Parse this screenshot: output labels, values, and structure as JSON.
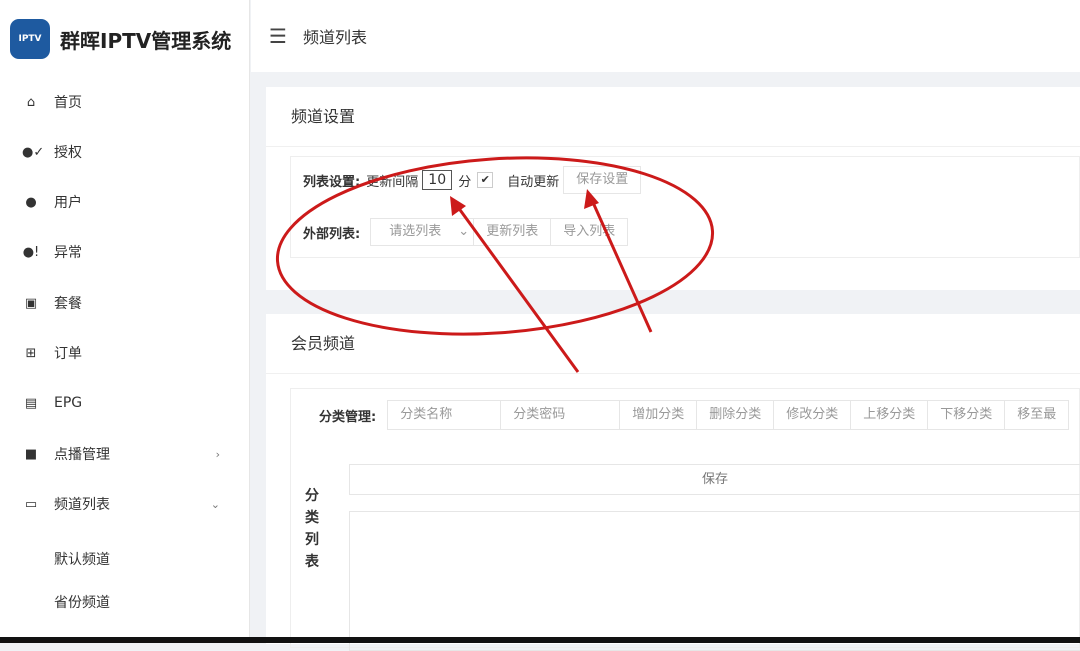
{
  "app": {
    "title": "群晖IPTV管理系统",
    "logo_text": "IPTV"
  },
  "header": {
    "title": "频道列表"
  },
  "sidebar": {
    "items": [
      {
        "label": "首页",
        "icon": "home-icon"
      },
      {
        "label": "授权",
        "icon": "user-check-icon"
      },
      {
        "label": "用户",
        "icon": "user-icon"
      },
      {
        "label": "异常",
        "icon": "user-alert-icon"
      },
      {
        "label": "套餐",
        "icon": "bag-icon"
      },
      {
        "label": "订单",
        "icon": "gift-icon"
      },
      {
        "label": "EPG",
        "icon": "epg-icon"
      },
      {
        "label": "点播管理",
        "icon": "js-icon"
      },
      {
        "label": "频道列表",
        "icon": "tv-icon"
      }
    ],
    "subitems": [
      "默认频道",
      "省份频道"
    ]
  },
  "channel_settings": {
    "title": "频道设置",
    "list_label": "列表设置:",
    "interval_label": "更新间隔",
    "interval_value": "10",
    "unit": "分",
    "auto_checked": true,
    "auto_label": "自动更新",
    "save_label": "保存设置",
    "external_label": "外部列表:",
    "select_placeholder": "请选列表",
    "update_list": "更新列表",
    "import_list": "导入列表"
  },
  "member_channels": {
    "title": "会员频道",
    "category_label": "分类管理:",
    "name_placeholder": "分类名称",
    "password_placeholder": "分类密码",
    "buttons": [
      "增加分类",
      "删除分类",
      "修改分类",
      "上移分类",
      "下移分类",
      "移至最"
    ],
    "list_label": [
      "分",
      "类",
      "列",
      "表"
    ],
    "save_label": "保存"
  },
  "colors": {
    "annotation": "#cc1a1a",
    "logo": "#1e5aa0"
  }
}
